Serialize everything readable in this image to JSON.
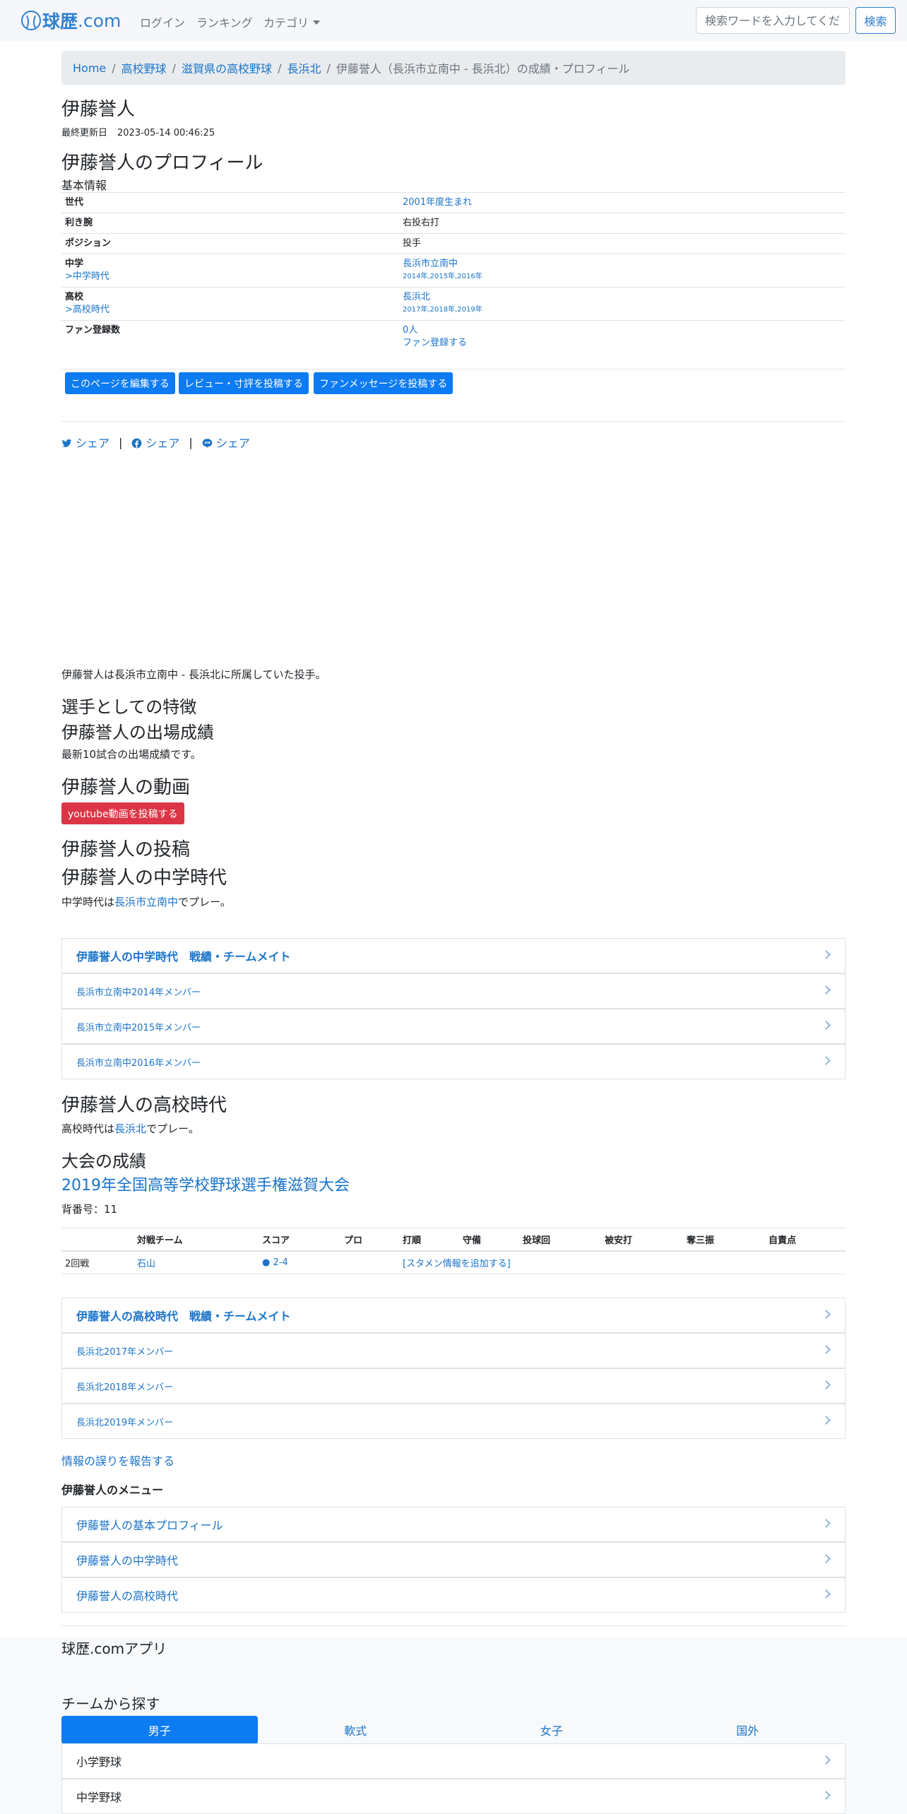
{
  "header": {
    "brand_kanji": "球歴",
    "brand_suffix": ".com",
    "nav": {
      "login": "ログイン",
      "ranking": "ランキング",
      "category": "カテゴリ"
    },
    "search_placeholder": "検索ワードを入力してください",
    "search_button": "検索"
  },
  "breadcrumb": [
    "Home",
    "高校野球",
    "滋賀県の高校野球",
    "長浜北",
    "伊藤誉人（長浜市立南中 - 長浜北）の成績・プロフィール"
  ],
  "player": {
    "name": "伊藤誉人",
    "updated_label": "最終更新日",
    "updated_value": "2023-05-14 00:46:25"
  },
  "profile": {
    "heading": "伊藤誉人のプロフィール",
    "subheading": "基本情報",
    "rows": {
      "generation_k": "世代",
      "generation_v": "2001年度生まれ",
      "hand_k": "利き腕",
      "hand_v": "右投右打",
      "position_k": "ポジション",
      "position_v": "投手",
      "jhs_k": "中学",
      "jhs_link": ">中学時代",
      "jhs_v": "長浜市立南中",
      "jhs_years": "2014年,2015年,2016年",
      "hs_k": "高校",
      "hs_link": ">高校時代",
      "hs_v": "長浜北",
      "hs_years": "2017年,2018年,2019年",
      "fans_k": "ファン登録数",
      "fans_v": "0人",
      "fans_link": "ファン登録する"
    },
    "buttons": {
      "edit": "このページを編集する",
      "review": "レビュー・寸評を投稿する",
      "message": "ファンメッセージを投稿する"
    }
  },
  "share": {
    "twitter": "シェア",
    "facebook": "シェア",
    "line": "シェア",
    "sep": "|"
  },
  "intro": "伊藤誉人は長浜市立南中 - 長浜北に所属していた投手。",
  "sections": {
    "features": "選手としての特徴",
    "results": "伊藤誉人の出場成績",
    "results_note": "最新10試合の出場成績です。",
    "videos": "伊藤誉人の動画",
    "youtube_button": "youtube動画を投稿する",
    "posts": "伊藤誉人の投稿",
    "jhs_heading": "伊藤誉人の中学時代",
    "jhs_pre": "中学時代は",
    "jhs_team": "長浜市立南中",
    "jhs_post": "でプレー。",
    "hs_heading": "伊藤誉人の高校時代",
    "hs_pre": "高校時代は",
    "hs_team": "長浜北",
    "hs_post": "でプレー。",
    "tournament_heading": "大会の成績",
    "tournament_title": "2019年全国高等学校野球選手権滋賀大会",
    "uniform_number": "背番号：11"
  },
  "jhs_list": {
    "head": "伊藤誉人の中学時代　戦績・チームメイト",
    "items": [
      "長浜市立南中2014年メンバー",
      "長浜市立南中2015年メンバー",
      "長浜市立南中2016年メンバー"
    ]
  },
  "stats": {
    "headers": [
      "",
      "対戦チーム",
      "スコア",
      "プロ",
      "打順",
      "守備",
      "投球回",
      "被安打",
      "奪三振",
      "自責点"
    ],
    "row": {
      "round": "2回戦",
      "opponent": "石山",
      "score": "● 2-4",
      "starting": "[スタメン情報を追加する]"
    }
  },
  "hs_list": {
    "head": "伊藤誉人の高校時代　戦績・チームメイト",
    "items": [
      "長浜北2017年メンバー",
      "長浜北2018年メンバー",
      "長浜北2019年メンバー"
    ]
  },
  "report_link": "情報の誤りを報告する",
  "menu": {
    "heading": "伊藤誉人のメニュー",
    "items": [
      "伊藤誉人の基本プロフィール",
      "伊藤誉人の中学時代",
      "伊藤誉人の高校時代"
    ]
  },
  "footer": {
    "app": "球歴.comアプリ",
    "teams_heading": "チームから探す",
    "tabs": [
      "男子",
      "軟式",
      "女子",
      "国外"
    ],
    "list": [
      "小学野球",
      "中学野球"
    ]
  },
  "colors": {
    "primary": "#0d7bf2",
    "link": "#1a73c8",
    "danger": "#dc3545",
    "brand": "#2f7fd0"
  }
}
